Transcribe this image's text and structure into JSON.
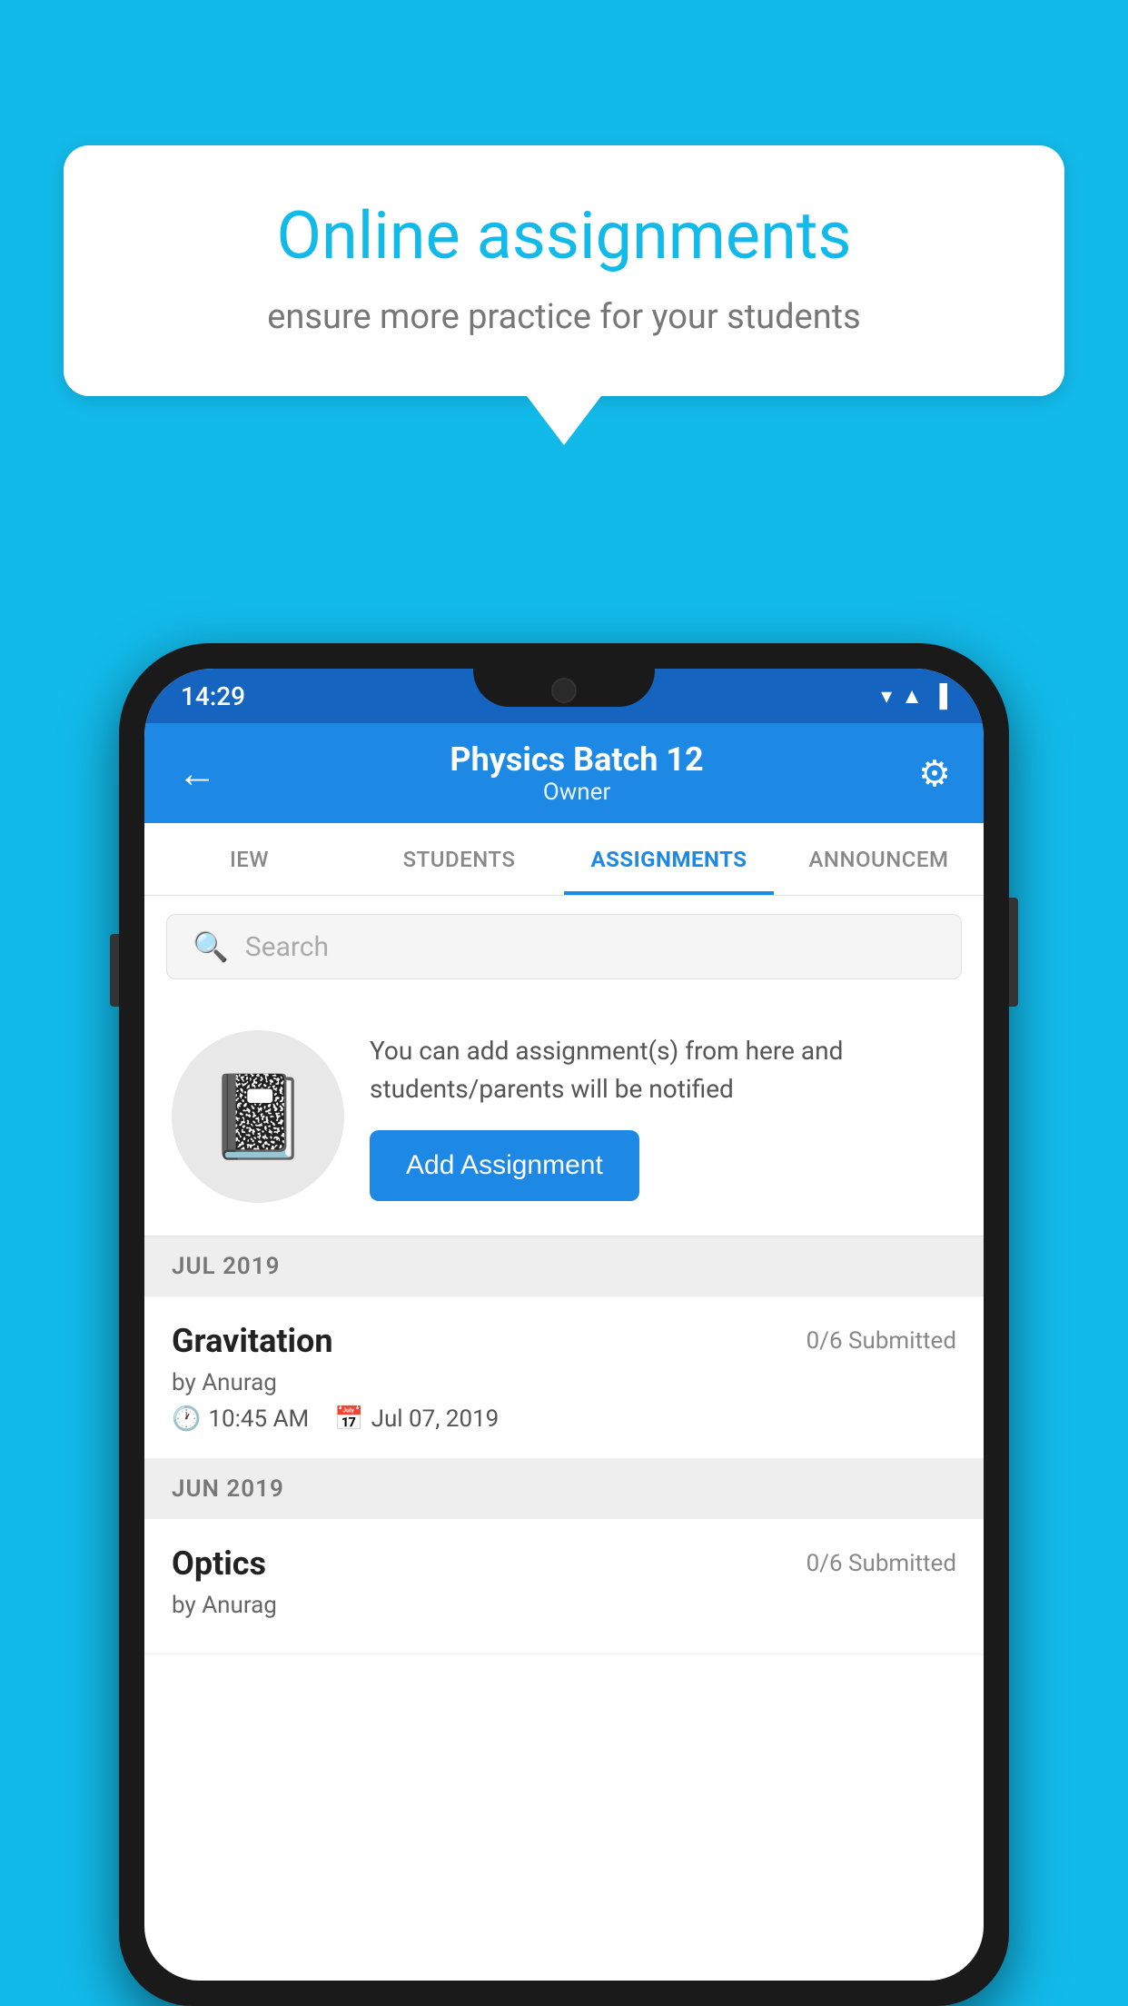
{
  "background_color": "#12BAEA",
  "speech_bubble": {
    "title": "Online assignments",
    "subtitle": "ensure more practice for your students"
  },
  "status_bar": {
    "time": "14:29",
    "icons": [
      "wifi",
      "signal",
      "battery"
    ]
  },
  "app_bar": {
    "title": "Physics Batch 12",
    "subtitle": "Owner",
    "back_icon": "←",
    "settings_icon": "⚙"
  },
  "tabs": [
    {
      "label": "IEW",
      "active": false
    },
    {
      "label": "STUDENTS",
      "active": false
    },
    {
      "label": "ASSIGNMENTS",
      "active": true
    },
    {
      "label": "ANNOUNCEM",
      "active": false
    }
  ],
  "search": {
    "placeholder": "Search"
  },
  "promo": {
    "text": "You can add assignment(s) from here and students/parents will be notified",
    "button_label": "Add Assignment"
  },
  "sections": [
    {
      "label": "JUL 2019",
      "assignments": [
        {
          "name": "Gravitation",
          "submitted": "0/6 Submitted",
          "by": "by Anurag",
          "time": "10:45 AM",
          "date": "Jul 07, 2019"
        }
      ]
    },
    {
      "label": "JUN 2019",
      "assignments": [
        {
          "name": "Optics",
          "submitted": "0/6 Submitted",
          "by": "by Anurag",
          "time": "",
          "date": ""
        }
      ]
    }
  ]
}
